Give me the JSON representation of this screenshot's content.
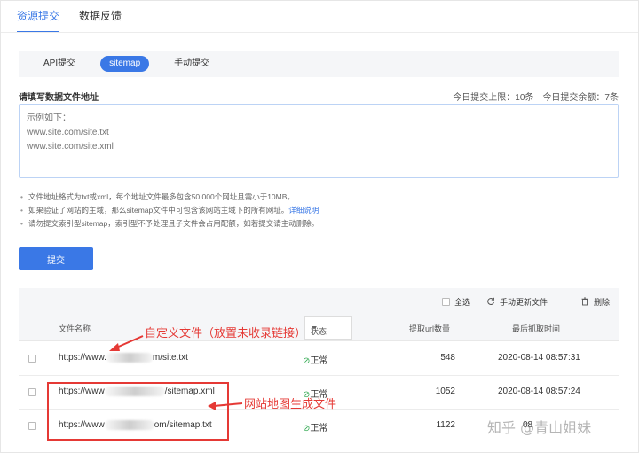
{
  "top_tabs": [
    {
      "label": "资源提交",
      "active": true
    },
    {
      "label": "数据反馈",
      "active": false
    }
  ],
  "sub_tabs": [
    {
      "label": "API提交",
      "active": false
    },
    {
      "label": "sitemap",
      "active": true
    },
    {
      "label": "手动提交",
      "active": false
    }
  ],
  "form": {
    "label": "请填写数据文件地址",
    "quota_limit": "今日提交上限：10条",
    "quota_remaining": "今日提交余额：7条",
    "placeholder": "示例如下：\nwww.site.com/site.txt\nwww.site.com/site.xml"
  },
  "notes": {
    "note1": "文件地址格式为txt或xml，每个地址文件最多包含50,000个网址且需小于10MB。",
    "note2_text": "如果验证了网站的主域，那么sitemap文件中可包含该网站主域下的所有网址。",
    "note2_link": "详细说明",
    "note3": "请勿提交索引型sitemap，索引型不予处理且子文件会占用配额，如若提交请主动删除。"
  },
  "submit_label": "提交",
  "toolbar": {
    "select_all": "全选",
    "refresh": "手动更新文件",
    "refresh_icon": "refresh-icon",
    "delete": "删除",
    "delete_icon": "trash-icon"
  },
  "table": {
    "headers": {
      "filename": "文件名称",
      "status": "状态",
      "url_count": "提取url数量",
      "last_fetch": "最后抓取时间"
    },
    "rows": [
      {
        "url_prefix": "https://www.",
        "url_suffix": "m/site.txt",
        "status": "正常",
        "count": "548",
        "time": "2020-08-14 08:57:31"
      },
      {
        "url_prefix": "https://www",
        "url_suffix": "/sitemap.xml",
        "status": "正常",
        "count": "1052",
        "time": "2020-08-14 08:57:24"
      },
      {
        "url_prefix": "https://www",
        "url_suffix": "om/sitemap.txt",
        "status": "正常",
        "count": "1122",
        "time": "08"
      }
    ]
  },
  "annotations": {
    "custom_file": "自定义文件（放置未收录链接）",
    "generated": "网站地图生成文件",
    "color": "#e53935"
  },
  "watermark": "知乎 @青山姐妹",
  "colors": {
    "accent": "#3a78e6",
    "ok": "#2fa84f",
    "annotation": "#e53935"
  }
}
